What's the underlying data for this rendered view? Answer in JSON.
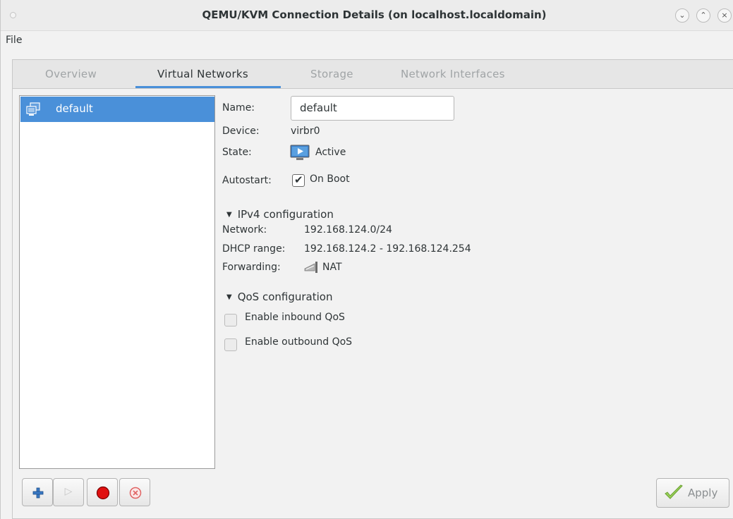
{
  "window": {
    "title": "QEMU/KVM Connection Details (on localhost.localdomain)",
    "controls": [
      "minimize",
      "maximize",
      "close"
    ]
  },
  "menubar": {
    "file": "File"
  },
  "tabs": [
    {
      "label": "Overview",
      "active": false
    },
    {
      "label": "Virtual Networks",
      "active": true
    },
    {
      "label": "Storage",
      "active": false
    },
    {
      "label": "Network Interfaces",
      "active": false
    }
  ],
  "networks": [
    {
      "name": "default",
      "icon": "network-icon",
      "selected": true
    }
  ],
  "details": {
    "name_label": "Name:",
    "name_value": "default",
    "device_label": "Device:",
    "device_value": "virbr0",
    "state_label": "State:",
    "state_value": "Active",
    "autostart_label": "Autostart:",
    "autostart_value": "On Boot",
    "autostart_checked": true
  },
  "ipv4": {
    "header": "IPv4 configuration",
    "network_label": "Network:",
    "network_value": "192.168.124.0/24",
    "dhcp_label": "DHCP range:",
    "dhcp_value": "192.168.124.2 - 192.168.124.254",
    "forwarding_label": "Forwarding:",
    "forwarding_value": "NAT"
  },
  "qos": {
    "header": "QoS configuration",
    "inbound_label": "Enable inbound QoS",
    "inbound_checked": false,
    "outbound_label": "Enable outbound QoS",
    "outbound_checked": false
  },
  "toolbar": {
    "add": "add-icon",
    "start": "play-icon",
    "stop": "stop-icon",
    "delete": "delete-icon"
  },
  "apply_label": "Apply",
  "colors": {
    "accent": "#4a90d9",
    "stop_red": "#e01010",
    "delete_red": "#e06464",
    "apply_green": "#7cbf3c"
  }
}
